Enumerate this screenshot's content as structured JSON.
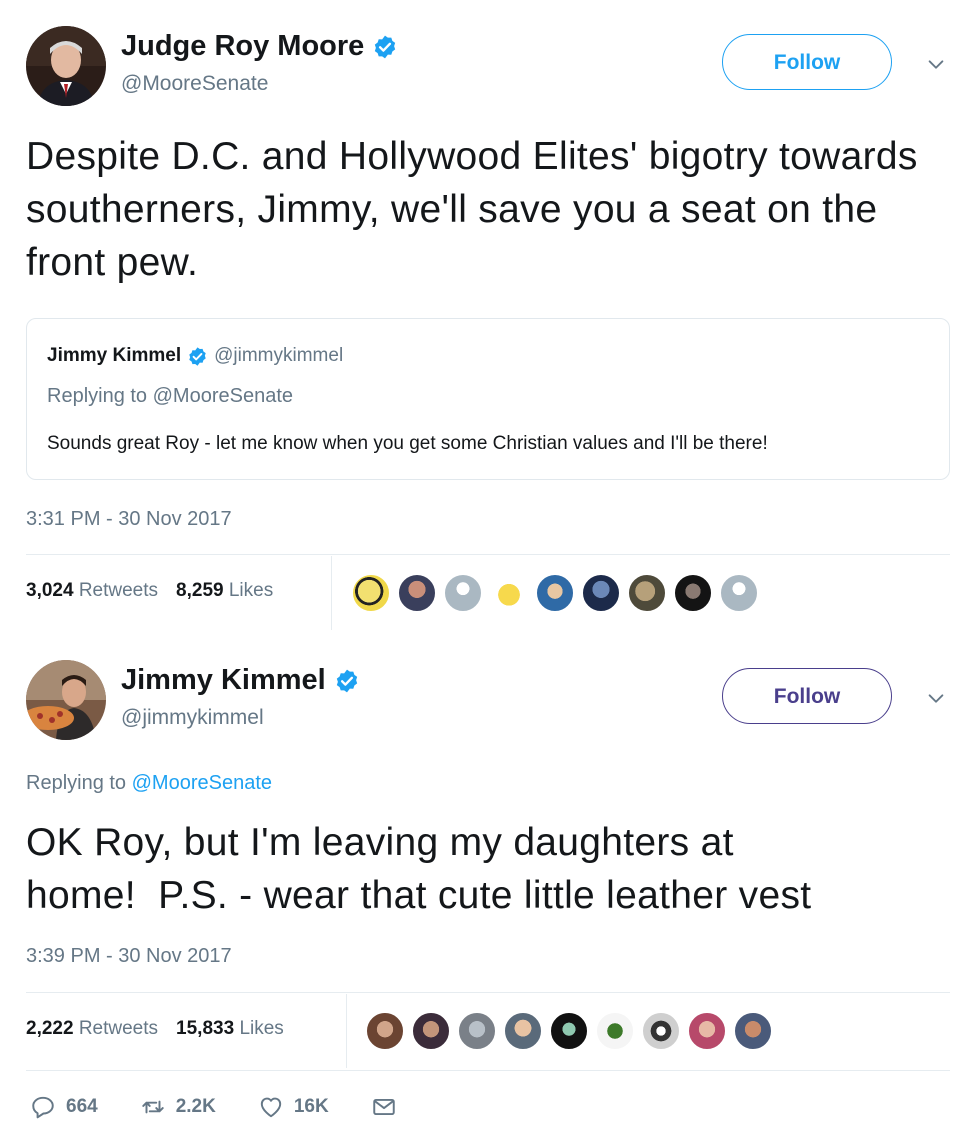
{
  "tweet1": {
    "name": "Judge Roy Moore",
    "handle": "@MooreSenate",
    "follow_label": "Follow",
    "text": "Despite D.C. and Hollywood Elites' bigotry towards southerners, Jimmy, we'll save you a seat on the front pew.",
    "quote": {
      "name": "Jimmy Kimmel",
      "handle": "@jimmykimmel",
      "replying_prefix": "Replying to ",
      "replying_to": "@MooreSenate",
      "text": "Sounds great Roy - let me know when you get some Christian values and I'll be there!"
    },
    "timestamp": "3:31 PM - 30 Nov 2017",
    "retweets": "3,024",
    "retweets_label": "Retweets",
    "likes": "8,259",
    "likes_label": "Likes"
  },
  "tweet2": {
    "name": "Jimmy Kimmel",
    "handle": "@jimmykimmel",
    "follow_label": "Follow",
    "replying_prefix": "Replying to ",
    "replying_to": "@MooreSenate",
    "text_line1": "OK Roy, but I'm leaving my daughters at",
    "text_line2": "home!  P.S. - wear that cute little leather vest",
    "timestamp": "3:39 PM - 30 Nov 2017",
    "retweets": "2,222",
    "retweets_label": "Retweets",
    "likes": "15,833",
    "likes_label": "Likes",
    "actions": {
      "replies": "664",
      "retweets": "2.2K",
      "likes": "16K"
    }
  },
  "icons": {
    "verified": "verified-badge-icon",
    "chevron": "chevron-down-icon",
    "reply": "reply-icon",
    "retweet": "retweet-icon",
    "like": "heart-icon",
    "dm": "envelope-icon"
  },
  "colors": {
    "verified": "#1da1f2",
    "follow1": "#1da1f2",
    "follow2": "#4a3f8c",
    "link": "#1da1f2",
    "muted": "#657786"
  }
}
